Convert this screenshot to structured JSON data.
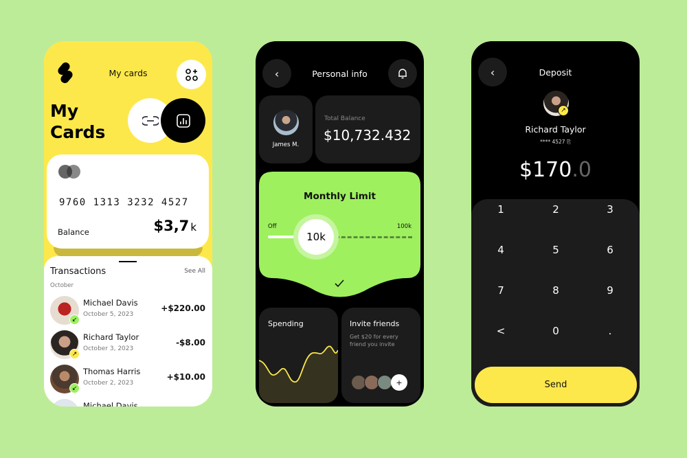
{
  "colors": {
    "background": "#bdec99",
    "yellow": "#fde84b",
    "green": "#9ef05f",
    "dark": "#1c1c1c"
  },
  "cards_screen": {
    "header_title": "My cards",
    "logo_icon": "s-logo-icon",
    "add_widget_icon": "grid-plus-icon",
    "page_title_line1": "My",
    "page_title_line2": "Cards",
    "link_icon": "link-icon",
    "chart_icon": "bar-chart-icon",
    "card": {
      "brand_icon": "mastercard-icon",
      "number": "9760 1313 3232 4527",
      "balance_label": "Balance",
      "balance_value": "$3,7",
      "balance_suffix": "k"
    },
    "transactions": {
      "title": "Transactions",
      "see_all": "See All",
      "month": "October",
      "items": [
        {
          "name": "Michael Davis",
          "date": "October 5, 2023",
          "amount": "+$220.00",
          "direction": "incoming"
        },
        {
          "name": "Richard Taylor",
          "date": "October 3, 2023",
          "amount": "-$8.00",
          "direction": "outgoing"
        },
        {
          "name": "Thomas Harris",
          "date": "October 2, 2023",
          "amount": "+$10.00",
          "direction": "incoming"
        },
        {
          "name": "Michael Davis"
        }
      ]
    }
  },
  "personal_screen": {
    "title": "Personal info",
    "user_name": "James M.",
    "balance_label": "Total Balance",
    "balance_value": "$10,732.432",
    "limit": {
      "title": "Monthly Limit",
      "min_label": "Off",
      "max_label": "100k",
      "value_label": "10k",
      "value_percent": 10
    },
    "spending_title": "Spending",
    "invite": {
      "title": "Invite friends",
      "text_line1": "Get $20 for every",
      "text_line2": "friend you invite",
      "add_label": "+"
    }
  },
  "deposit_screen": {
    "title": "Deposit",
    "recipient_name": "Richard Taylor",
    "card_masked": "**** 4527",
    "amount_main": "$170",
    "amount_decimal": ".0",
    "keys": [
      "1",
      "2",
      "3",
      "4",
      "5",
      "6",
      "7",
      "8",
      "9",
      "<",
      "0",
      "."
    ],
    "send_label": "Send"
  }
}
